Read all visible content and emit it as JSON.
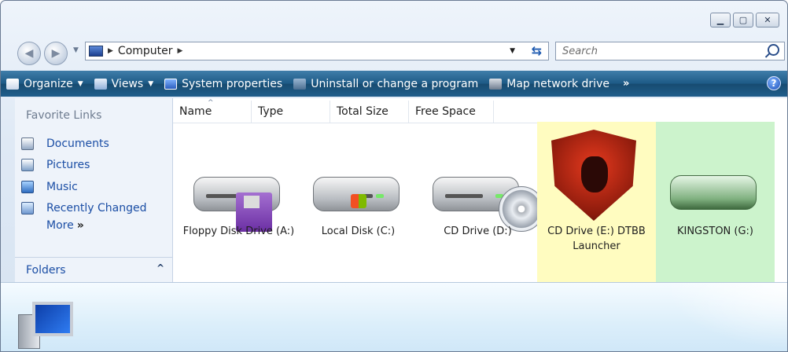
{
  "window": {
    "caption_buttons": [
      "minimize",
      "maximize",
      "close"
    ]
  },
  "address": {
    "crumbs": [
      "Computer"
    ],
    "search_placeholder": "Search"
  },
  "toolbar": {
    "items": [
      {
        "label": "Organize",
        "icon": "organize-icon",
        "dropdown": true
      },
      {
        "label": "Views",
        "icon": "views-icon",
        "dropdown": true
      },
      {
        "label": "System properties",
        "icon": "system-properties-icon"
      },
      {
        "label": "Uninstall or change a program",
        "icon": "uninstall-icon"
      },
      {
        "label": "Map network drive",
        "icon": "map-drive-icon"
      }
    ],
    "more": "»",
    "help": "?"
  },
  "nav": {
    "title": "Favorite Links",
    "links": [
      {
        "label": "Documents",
        "icon": "documents-icon"
      },
      {
        "label": "Pictures",
        "icon": "pictures-icon"
      },
      {
        "label": "Music",
        "icon": "music-icon"
      },
      {
        "label": "Recently Changed",
        "icon": "recently-changed-icon"
      }
    ],
    "more": "More",
    "more_glyph": "»",
    "folders": "Folders"
  },
  "columns": [
    "Name",
    "Type",
    "Total Size",
    "Free Space"
  ],
  "drives": [
    {
      "label": "Floppy Disk Drive (A:)",
      "icon": "floppy-drive-icon"
    },
    {
      "label": "Local Disk (C:)",
      "icon": "local-disk-icon"
    },
    {
      "label": "CD Drive (D:)",
      "icon": "cd-drive-icon"
    },
    {
      "label": "CD Drive (E:) DTBB Launcher",
      "icon": "kingston-shield-icon",
      "highlight": "#fffcc0"
    },
    {
      "label": "KINGSTON (G:)",
      "icon": "usb-drive-icon",
      "highlight": "#ccf3cc"
    }
  ],
  "details": {
    "icon": "computer-icon"
  }
}
